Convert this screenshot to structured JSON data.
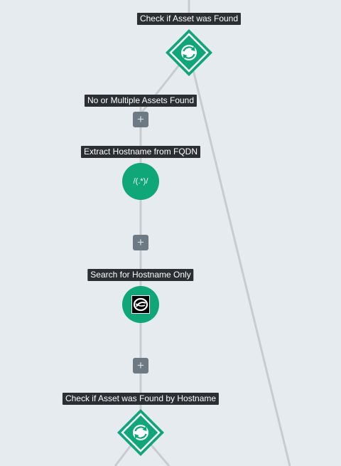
{
  "workflow": {
    "nodes": [
      {
        "id": "check-asset",
        "type": "decision",
        "label": "Check if Asset was Found",
        "icon": "refresh-cycle-icon"
      },
      {
        "id": "no-or-multiple",
        "type": "branch-label",
        "label": "No or Multiple Assets Found"
      },
      {
        "id": "extract-hostname",
        "type": "regex",
        "label": "Extract Hostname from FQDN",
        "content": "/(.*)/"
      },
      {
        "id": "search-hostname",
        "type": "app-action",
        "label": "Search for Hostname Only",
        "icon": "swirl-logo-icon"
      },
      {
        "id": "check-asset-hostname",
        "type": "decision",
        "label": "Check if Asset was Found by Hostname",
        "icon": "refresh-cycle-icon"
      }
    ],
    "add_step_glyph": "+"
  },
  "colors": {
    "background": "#e6ebef",
    "connector": "#c6ccd1",
    "node_green": "#0fa678",
    "label_bg": "#2b2f33",
    "label_text": "#ffffff",
    "add_button": "#6d7a83"
  }
}
